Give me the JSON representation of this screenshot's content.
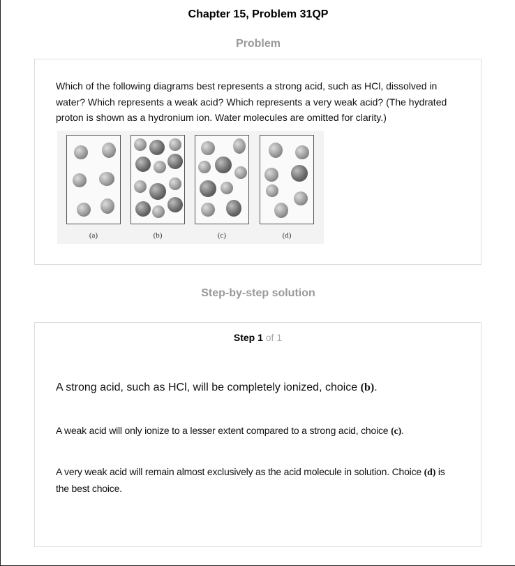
{
  "header": {
    "title": "Chapter 15, Problem 31QP"
  },
  "problem": {
    "heading": "Problem",
    "text": "Which of the following diagrams best represents a strong acid, such as HCl, dissolved in water? Which represents a weak acid? Which represents a very weak acid? (The hydrated proton is shown as a hydronium ion. Water molecules are omitted for clarity.)",
    "figure_labels": [
      "(a)",
      "(b)",
      "(c)",
      "(d)"
    ]
  },
  "solution": {
    "heading": "Step-by-step solution",
    "step_word": "Step 1",
    "step_of": " of 1",
    "p1": {
      "text": "A strong acid, such as HCl, will be completely ionized, choice ",
      "choice": "(b)",
      "end": "."
    },
    "p2": {
      "text": "A weak acid will only ionize to a lesser extent compared to a strong acid, choice ",
      "choice": "(c)",
      "end": "."
    },
    "p3": {
      "text": "A very weak acid will remain almost exclusively as the acid molecule in solution. Choice ",
      "choice": "(d)",
      "end": " is the best choice."
    }
  }
}
